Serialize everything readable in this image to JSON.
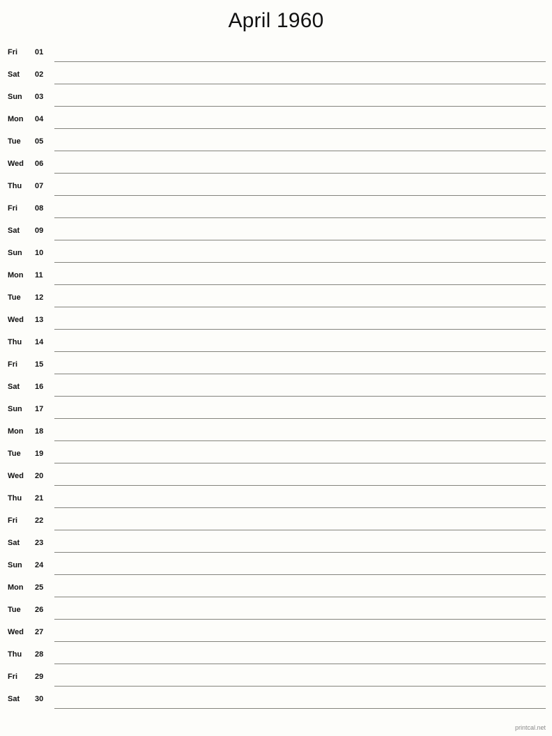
{
  "header": {
    "title": "April 1960"
  },
  "calendar": {
    "month_name": "April",
    "year": "1960",
    "rows": [
      {
        "weekday": "Fri",
        "day": "01"
      },
      {
        "weekday": "Sat",
        "day": "02"
      },
      {
        "weekday": "Sun",
        "day": "03"
      },
      {
        "weekday": "Mon",
        "day": "04"
      },
      {
        "weekday": "Tue",
        "day": "05"
      },
      {
        "weekday": "Wed",
        "day": "06"
      },
      {
        "weekday": "Thu",
        "day": "07"
      },
      {
        "weekday": "Fri",
        "day": "08"
      },
      {
        "weekday": "Sat",
        "day": "09"
      },
      {
        "weekday": "Sun",
        "day": "10"
      },
      {
        "weekday": "Mon",
        "day": "11"
      },
      {
        "weekday": "Tue",
        "day": "12"
      },
      {
        "weekday": "Wed",
        "day": "13"
      },
      {
        "weekday": "Thu",
        "day": "14"
      },
      {
        "weekday": "Fri",
        "day": "15"
      },
      {
        "weekday": "Sat",
        "day": "16"
      },
      {
        "weekday": "Sun",
        "day": "17"
      },
      {
        "weekday": "Mon",
        "day": "18"
      },
      {
        "weekday": "Tue",
        "day": "19"
      },
      {
        "weekday": "Wed",
        "day": "20"
      },
      {
        "weekday": "Thu",
        "day": "21"
      },
      {
        "weekday": "Fri",
        "day": "22"
      },
      {
        "weekday": "Sat",
        "day": "23"
      },
      {
        "weekday": "Sun",
        "day": "24"
      },
      {
        "weekday": "Mon",
        "day": "25"
      },
      {
        "weekday": "Tue",
        "day": "26"
      },
      {
        "weekday": "Wed",
        "day": "27"
      },
      {
        "weekday": "Thu",
        "day": "28"
      },
      {
        "weekday": "Fri",
        "day": "29"
      },
      {
        "weekday": "Sat",
        "day": "30"
      }
    ]
  },
  "footer": {
    "credit": "printcal.net"
  },
  "colors": {
    "page_background": "#fdfdfa",
    "text": "#111111",
    "title": "#121212",
    "rule_line": "#83837c",
    "footer_text": "#8a8a8a"
  }
}
